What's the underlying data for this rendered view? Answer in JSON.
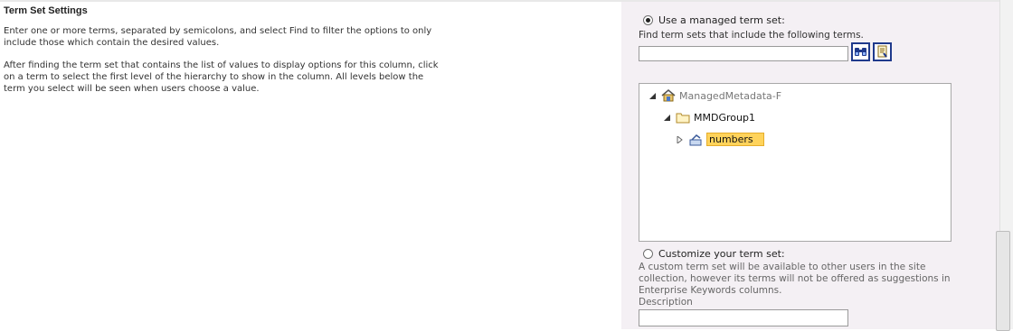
{
  "section": {
    "title": "Term Set Settings",
    "desc1": "Enter one or more terms, separated by semicolons, and select Find to filter the options to only include those which contain the desired values.",
    "desc2": "After finding the term set that contains the list of values to display options for this column, click on a term to select the first level of the hierarchy to show in the column. All levels below the term you select will be seen when users choose a value."
  },
  "managed": {
    "radio_label": "Use a managed term set:",
    "find_label": "Find term sets that include the following terms.",
    "find_value": "",
    "find_icon": "binoculars-icon",
    "browse_icon": "browse-term-icon"
  },
  "tree": {
    "root": "ManagedMetadata-F",
    "group": "MMDGroup1",
    "term_set": "numbers"
  },
  "custom": {
    "radio_label": "Customize your term set:",
    "description": "A custom term set will be available to other users in the site collection, however its terms will not be offered as suggestions in Enterprise Keywords columns.",
    "desc_field_label": "Description",
    "desc_value": ""
  },
  "colors": {
    "panel_bg": "#f4f0f4",
    "selected_bg": "#ffd35b",
    "button_border": "#1f3a8c"
  }
}
